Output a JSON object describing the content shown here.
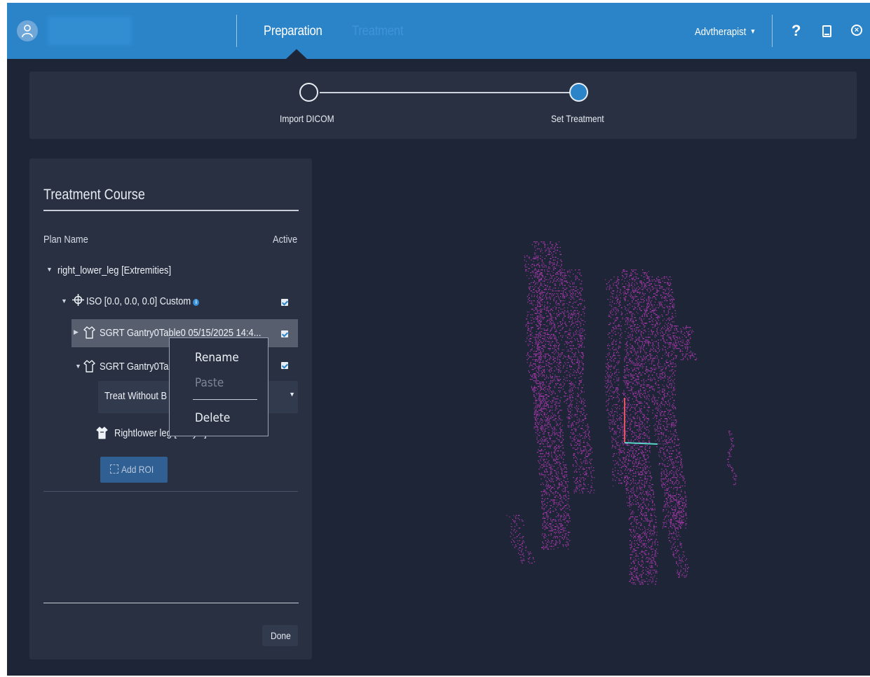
{
  "header": {
    "tabs": [
      {
        "label": "Preparation",
        "active": true
      },
      {
        "label": "Treatment",
        "active": false
      }
    ],
    "user_menu_label": "Advtherapist",
    "help_label": "?"
  },
  "stepper": {
    "steps": [
      {
        "label": "Import DICOM",
        "state": "done"
      },
      {
        "label": "Set Treatment",
        "state": "current"
      }
    ]
  },
  "panel": {
    "title": "Treatment Course",
    "column_plan": "Plan Name",
    "column_active": "Active",
    "tree": {
      "plan": "right_lower_leg [Extremities]",
      "iso": "ISO [0.0, 0.0, 0.0] Custom",
      "sgrt1": "SGRT Gantry0Table0 05/15/2025 14:4...",
      "sgrt2": "SGRT Gantry0Ta",
      "dropdown_value": "Treat Without B",
      "roi": "Rightlower leg [Body...]"
    },
    "add_roi_label": "Add ROI",
    "done_label": "Done"
  },
  "context_menu": {
    "items": [
      "Rename",
      "Paste",
      "Delete"
    ],
    "disabled": [
      "Paste"
    ]
  },
  "colors": {
    "accent": "#2b84c8",
    "background": "#1e2536",
    "panel": "#283042",
    "point_cloud": "#c03bc0"
  }
}
